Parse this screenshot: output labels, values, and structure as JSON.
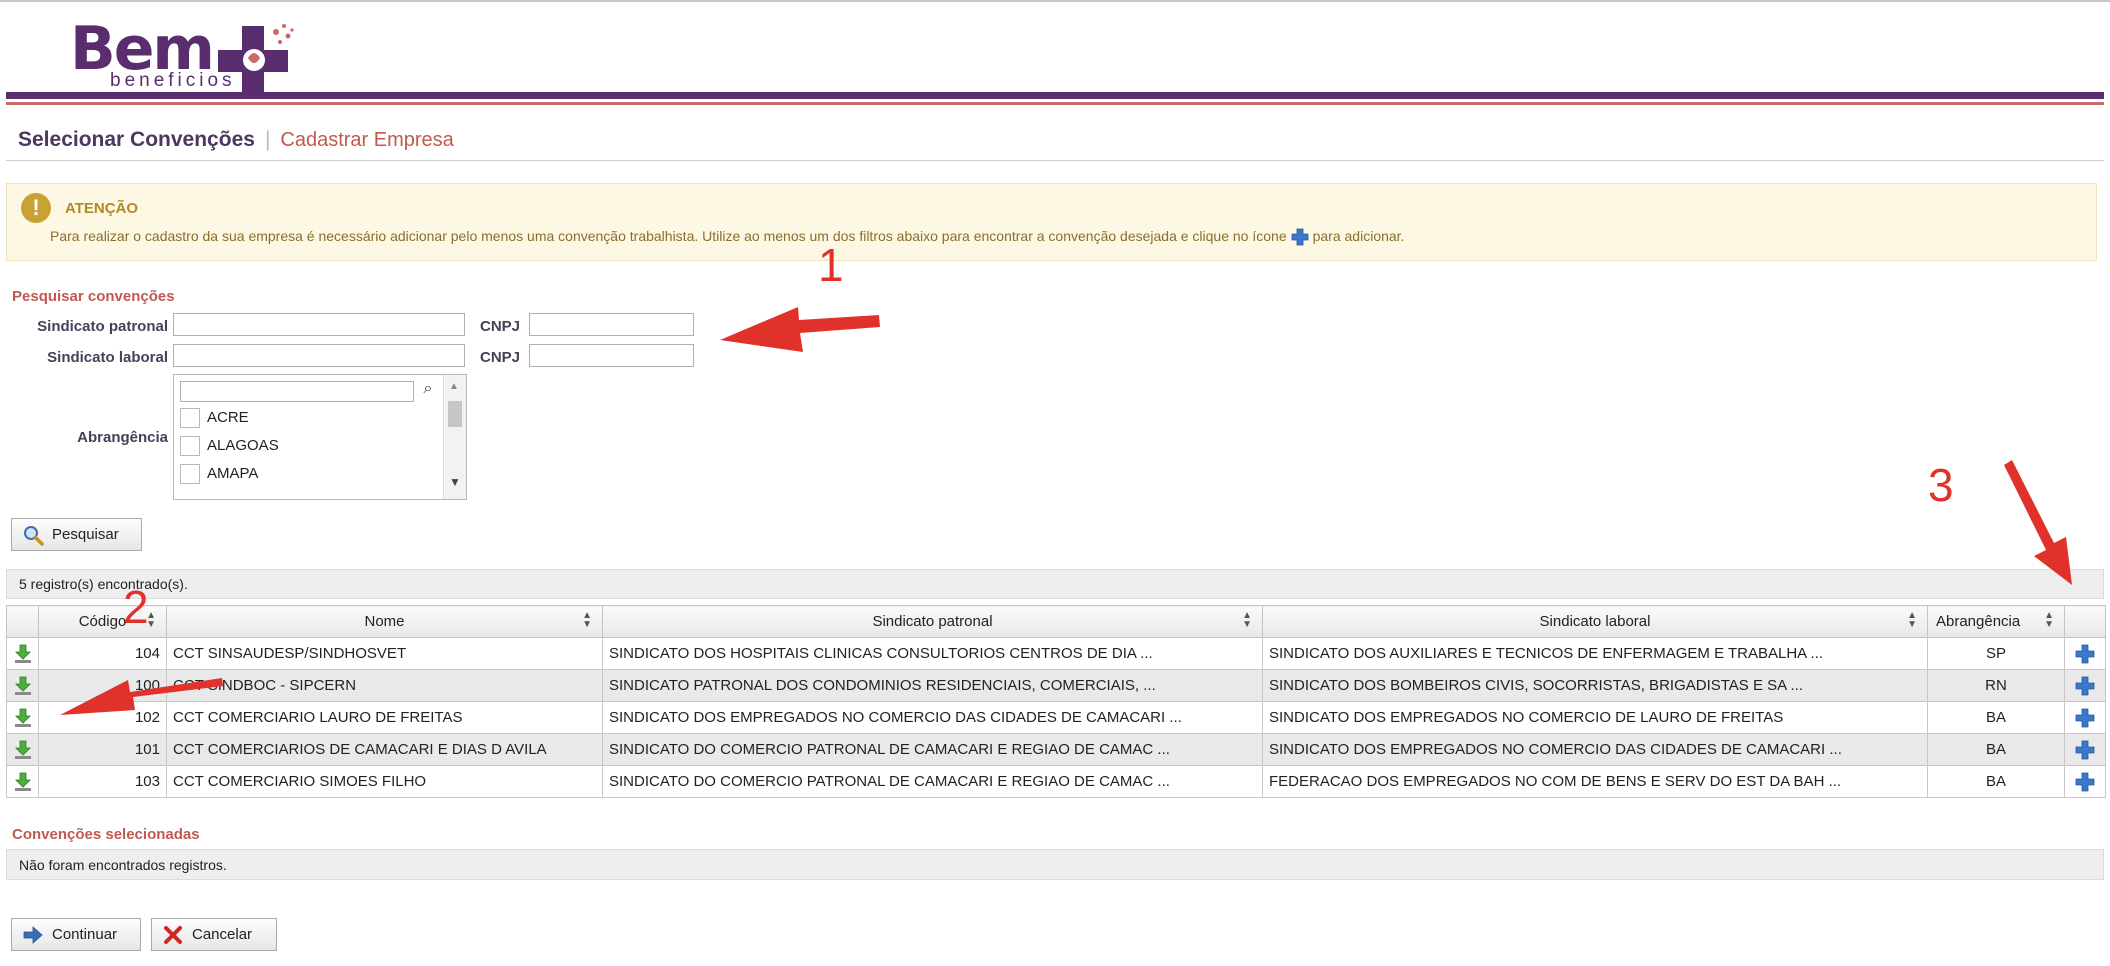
{
  "brand": {
    "logo_main": "Bem",
    "logo_sub": "beneficios"
  },
  "header": {
    "title": "Selecionar Convenções",
    "subtitle": "Cadastrar Empresa"
  },
  "alert": {
    "icon": "!",
    "title": "ATENÇÃO",
    "text_before": "Para realizar o cadastro da sua empresa é necessário adicionar pelo menos uma convenção trabalhista. Utilize ao menos um dos filtros abaixo para encontrar a convenção desejada e clique no ícone",
    "text_after": "para adicionar."
  },
  "search": {
    "section_title": "Pesquisar convenções",
    "sindicato_patronal_label": "Sindicato patronal",
    "sindicato_laboral_label": "Sindicato laboral",
    "cnpj_label": "CNPJ",
    "abrangencia_label": "Abrangência",
    "abrangencia_options": [
      "ACRE",
      "ALAGOAS",
      "AMAPA"
    ],
    "button_label": "Pesquisar"
  },
  "results": {
    "count_text": "5 registro(s) encontrado(s).",
    "columns": [
      "Código",
      "Nome",
      "Sindicato patronal",
      "Sindicato laboral",
      "Abrangência"
    ],
    "rows": [
      {
        "codigo": "104",
        "nome": "CCT SINSAUDESP/SINDHOSVET",
        "patronal": "SINDICATO DOS HOSPITAIS CLINICAS CONSULTORIOS CENTROS DE DIA ...",
        "laboral": "SINDICATO DOS AUXILIARES E TECNICOS DE ENFERMAGEM E TRABALHA ...",
        "abrangencia": "SP"
      },
      {
        "codigo": "100",
        "nome": "CCT SINDBOC - SIPCERN",
        "patronal": "SINDICATO PATRONAL DOS CONDOMINIOS RESIDENCIAIS, COMERCIAIS, ...",
        "laboral": "SINDICATO DOS BOMBEIROS CIVIS, SOCORRISTAS, BRIGADISTAS E SA ...",
        "abrangencia": "RN"
      },
      {
        "codigo": "102",
        "nome": "CCT COMERCIARIO LAURO DE FREITAS",
        "patronal": "SINDICATO DOS EMPREGADOS NO COMERCIO DAS CIDADES DE CAMACARI ...",
        "laboral": "SINDICATO DOS EMPREGADOS NO COMERCIO DE LAURO DE FREITAS",
        "abrangencia": "BA"
      },
      {
        "codigo": "101",
        "nome": "CCT COMERCIARIOS DE CAMACARI E DIAS D AVILA",
        "patronal": "SINDICATO DO COMERCIO PATRONAL DE CAMACARI E REGIAO DE CAMAC ...",
        "laboral": "SINDICATO DOS EMPREGADOS NO COMERCIO DAS CIDADES DE CAMACARI ...",
        "abrangencia": "BA"
      },
      {
        "codigo": "103",
        "nome": "CCT COMERCIARIO SIMOES FILHO",
        "patronal": "SINDICATO DO COMERCIO PATRONAL DE CAMACARI E REGIAO DE CAMAC ...",
        "laboral": "FEDERACAO DOS EMPREGADOS NO COM DE BENS E SERV DO EST DA BAH ...",
        "abrangencia": "BA"
      }
    ]
  },
  "selected": {
    "section_title": "Convenções selecionadas",
    "empty_text": "Não foram encontrados registros."
  },
  "actions": {
    "continue_label": "Continuar",
    "cancel_label": "Cancelar"
  },
  "annotations": {
    "n1": "1",
    "n2": "2",
    "n3": "3"
  },
  "colors": {
    "brand_purple": "#5a2d6e",
    "brand_red": "#c96a66",
    "accent_title": "#c05a50",
    "annotation_red": "#e0322a",
    "add_blue": "#3a78c9",
    "download_green": "#4caf3c"
  }
}
